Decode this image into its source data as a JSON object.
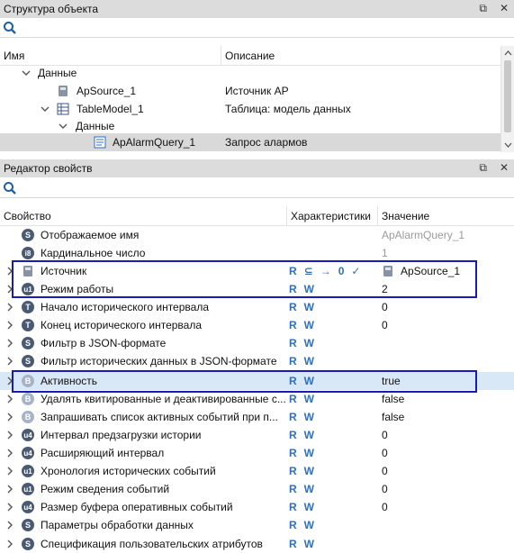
{
  "structure_panel": {
    "title": "Структура объекта",
    "columns": {
      "name": "Имя",
      "description": "Описание"
    },
    "tree": [
      {
        "name": "Данные",
        "description": ""
      },
      {
        "name": "ApSource_1",
        "description": "Источник AP"
      },
      {
        "name": "TableModel_1",
        "description": "Таблица: модель данных"
      },
      {
        "name": "Данные",
        "description": ""
      },
      {
        "name": "ApAlarmQuery_1",
        "description": "Запрос алармов"
      }
    ]
  },
  "properties_panel": {
    "title": "Редактор свойств",
    "columns": {
      "property": "Свойство",
      "characteristics": "Характеристики",
      "value": "Значение"
    },
    "rows": [
      {
        "icon": "S",
        "label": "Отображаемое имя",
        "chars": "",
        "value": "ApAlarmQuery_1"
      },
      {
        "icon": "i8",
        "label": "Кардинальное число",
        "chars": "",
        "value": "1"
      },
      {
        "icon": "obj",
        "label": "Источник",
        "chars": "R ⊆ → 0 ✓",
        "value": "ApSource_1"
      },
      {
        "icon": "u1",
        "label": "Режим работы",
        "chars": "R W",
        "value": "2"
      },
      {
        "icon": "T",
        "label": "Начало исторического интервала",
        "chars": "R W",
        "value": "0"
      },
      {
        "icon": "T",
        "label": "Конец исторического интервала",
        "chars": "R W",
        "value": "0"
      },
      {
        "icon": "S",
        "label": "Фильтр в JSON-формате",
        "chars": "R W",
        "value": ""
      },
      {
        "icon": "S",
        "label": "Фильтр исторических данных в JSON-формате",
        "chars": "R W",
        "value": ""
      },
      {
        "icon": "B",
        "label": "Активность",
        "chars": "R W",
        "value": "true"
      },
      {
        "icon": "B",
        "label": "Удалять квитированные и деактивированные с...",
        "chars": "R W",
        "value": "false"
      },
      {
        "icon": "B",
        "label": "Запрашивать список активных событий при п...",
        "chars": "R W",
        "value": "false"
      },
      {
        "icon": "u4",
        "label": "Интервал предзагрузки истории",
        "chars": "R W",
        "value": "0"
      },
      {
        "icon": "u4",
        "label": "Расширяющий интервал",
        "chars": "R W",
        "value": "0"
      },
      {
        "icon": "u1",
        "label": "Хронология исторических событий",
        "chars": "R W",
        "value": "0"
      },
      {
        "icon": "u1",
        "label": "Режим сведения событий",
        "chars": "R W",
        "value": "0"
      },
      {
        "icon": "u4",
        "label": "Размер буфера оперативных событий",
        "chars": "R W",
        "value": "0"
      },
      {
        "icon": "S",
        "label": "Параметры обработки данных",
        "chars": "R W",
        "value": ""
      },
      {
        "icon": "S",
        "label": "Спецификация пользовательских атрибутов",
        "chars": "R W",
        "value": ""
      }
    ]
  },
  "colors": {
    "accent": "#2f6fbf",
    "highlight_border": "#1a1ab4",
    "selected_row": "#d9e8f7",
    "panel_title_bg": "#dcdcdc"
  }
}
